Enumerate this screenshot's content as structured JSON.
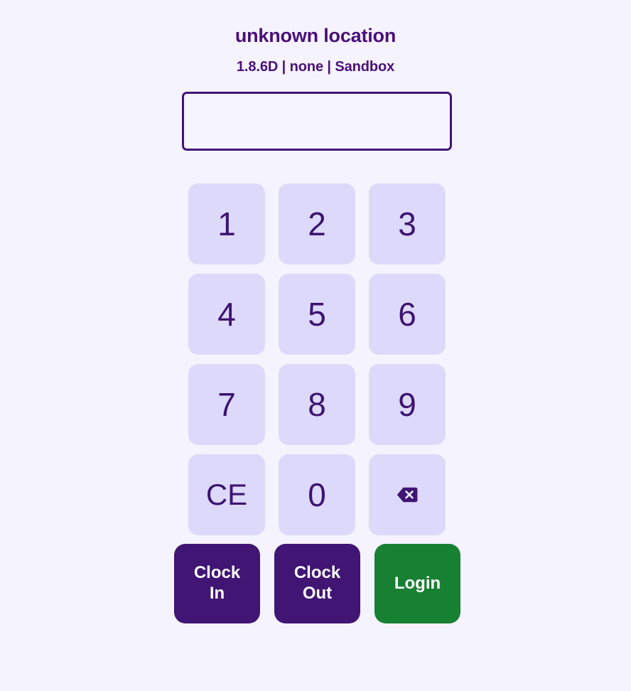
{
  "header": {
    "title": "unknown location",
    "subtitle": "1.8.6D | none | Sandbox",
    "version": "1.8.6D",
    "device": "none",
    "environment": "Sandbox"
  },
  "pin_display": {
    "value": "",
    "placeholder": ""
  },
  "keypad": {
    "keys": [
      {
        "label": "1",
        "name": "key-1",
        "type": "digit"
      },
      {
        "label": "2",
        "name": "key-2",
        "type": "digit"
      },
      {
        "label": "3",
        "name": "key-3",
        "type": "digit"
      },
      {
        "label": "4",
        "name": "key-4",
        "type": "digit"
      },
      {
        "label": "5",
        "name": "key-5",
        "type": "digit"
      },
      {
        "label": "6",
        "name": "key-6",
        "type": "digit"
      },
      {
        "label": "7",
        "name": "key-7",
        "type": "digit"
      },
      {
        "label": "8",
        "name": "key-8",
        "type": "digit"
      },
      {
        "label": "9",
        "name": "key-9",
        "type": "digit"
      },
      {
        "label": "CE",
        "name": "key-clear-entry",
        "type": "clear"
      },
      {
        "label": "0",
        "name": "key-0",
        "type": "digit"
      },
      {
        "label": "",
        "name": "key-backspace",
        "type": "backspace",
        "icon": "backspace-icon"
      }
    ]
  },
  "actions": {
    "clock_in": "Clock\nIn",
    "clock_out": "Clock\nOut",
    "login": "Login"
  },
  "colors": {
    "page_background": "#f5f3fd",
    "accent_purple": "#401573",
    "title_purple": "#4a1079",
    "key_background": "#ddd9fa",
    "key_text": "#3d1472",
    "login_green": "#188033",
    "action_text": "#ffffff"
  }
}
